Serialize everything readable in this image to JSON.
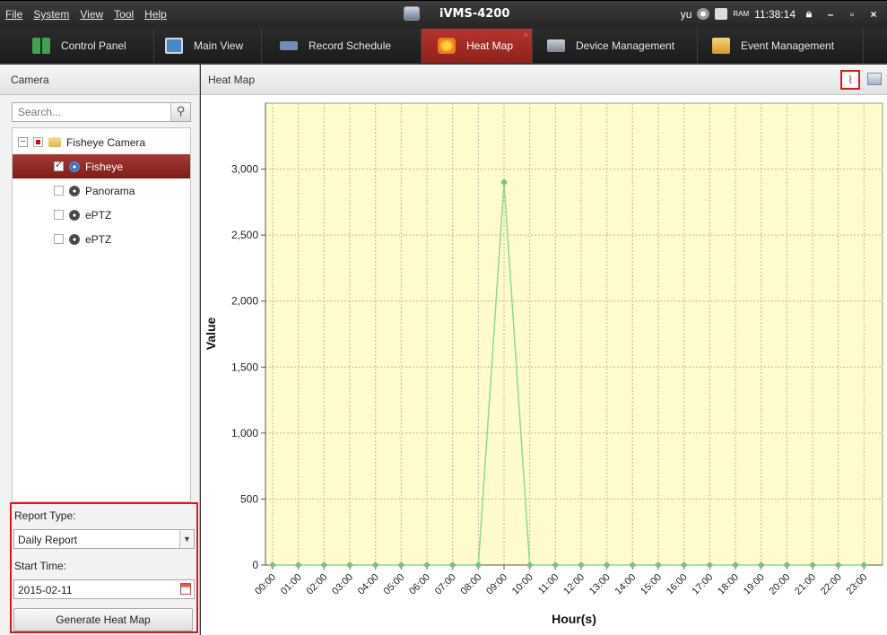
{
  "menu": [
    "File",
    "System",
    "View",
    "Tool",
    "Help"
  ],
  "app": {
    "title": "iVMS-4200",
    "user": "yu",
    "ram_label": "RAM",
    "clock": "11:38:14"
  },
  "tabs": [
    {
      "label": "Control Panel",
      "icon": "grid-icon",
      "color": "#3fa34d"
    },
    {
      "label": "Main View",
      "icon": "monitor-icon",
      "color": "#4b86c9"
    },
    {
      "label": "Record Schedule",
      "icon": "camera-record-icon",
      "color": "#6f8fb8"
    },
    {
      "label": "Heat Map",
      "icon": "heat-map-icon",
      "color": "#f07a1a",
      "active": true
    },
    {
      "label": "Device Management",
      "icon": "device-icon",
      "color": "#9aa6b8"
    },
    {
      "label": "Event Management",
      "icon": "folder-alert-icon",
      "color": "#e9b23b"
    }
  ],
  "left": {
    "header": "Camera",
    "search_placeholder": "Search...",
    "tree": {
      "root": "Fisheye Camera",
      "children": [
        {
          "label": "Fisheye",
          "checked": true,
          "selected": true
        },
        {
          "label": "Panorama",
          "checked": false
        },
        {
          "label": "ePTZ",
          "checked": false
        },
        {
          "label": "ePTZ",
          "checked": false
        }
      ]
    },
    "report_type_label": "Report Type:",
    "report_type_value": "Daily Report",
    "start_time_label": "Start Time:",
    "start_time_value": "2015-02-11",
    "generate_label": "Generate Heat Map"
  },
  "right": {
    "header": "Heat Map"
  },
  "chart_data": {
    "type": "line",
    "x": [
      "00:00",
      "01:00",
      "02:00",
      "03:00",
      "04:00",
      "05:00",
      "06:00",
      "07:00",
      "08:00",
      "09:00",
      "10:00",
      "11:00",
      "12:00",
      "13:00",
      "14:00",
      "15:00",
      "16:00",
      "17:00",
      "18:00",
      "19:00",
      "20:00",
      "21:00",
      "22:00",
      "23:00"
    ],
    "values": [
      0,
      0,
      0,
      0,
      0,
      0,
      0,
      0,
      0,
      2900,
      0,
      0,
      0,
      0,
      0,
      0,
      0,
      0,
      0,
      0,
      0,
      0,
      0,
      0
    ],
    "xlabel": "Hour(s)",
    "ylabel": "Value",
    "yticks": [
      "0",
      "500",
      "1,000",
      "1,500",
      "2,000",
      "2,500",
      "3,000"
    ],
    "ylim": [
      0,
      3500
    ],
    "grid": true,
    "plot_background": "#fffbcc",
    "line_color": "#8ddc8d",
    "marker_color": "#7cc27c"
  }
}
